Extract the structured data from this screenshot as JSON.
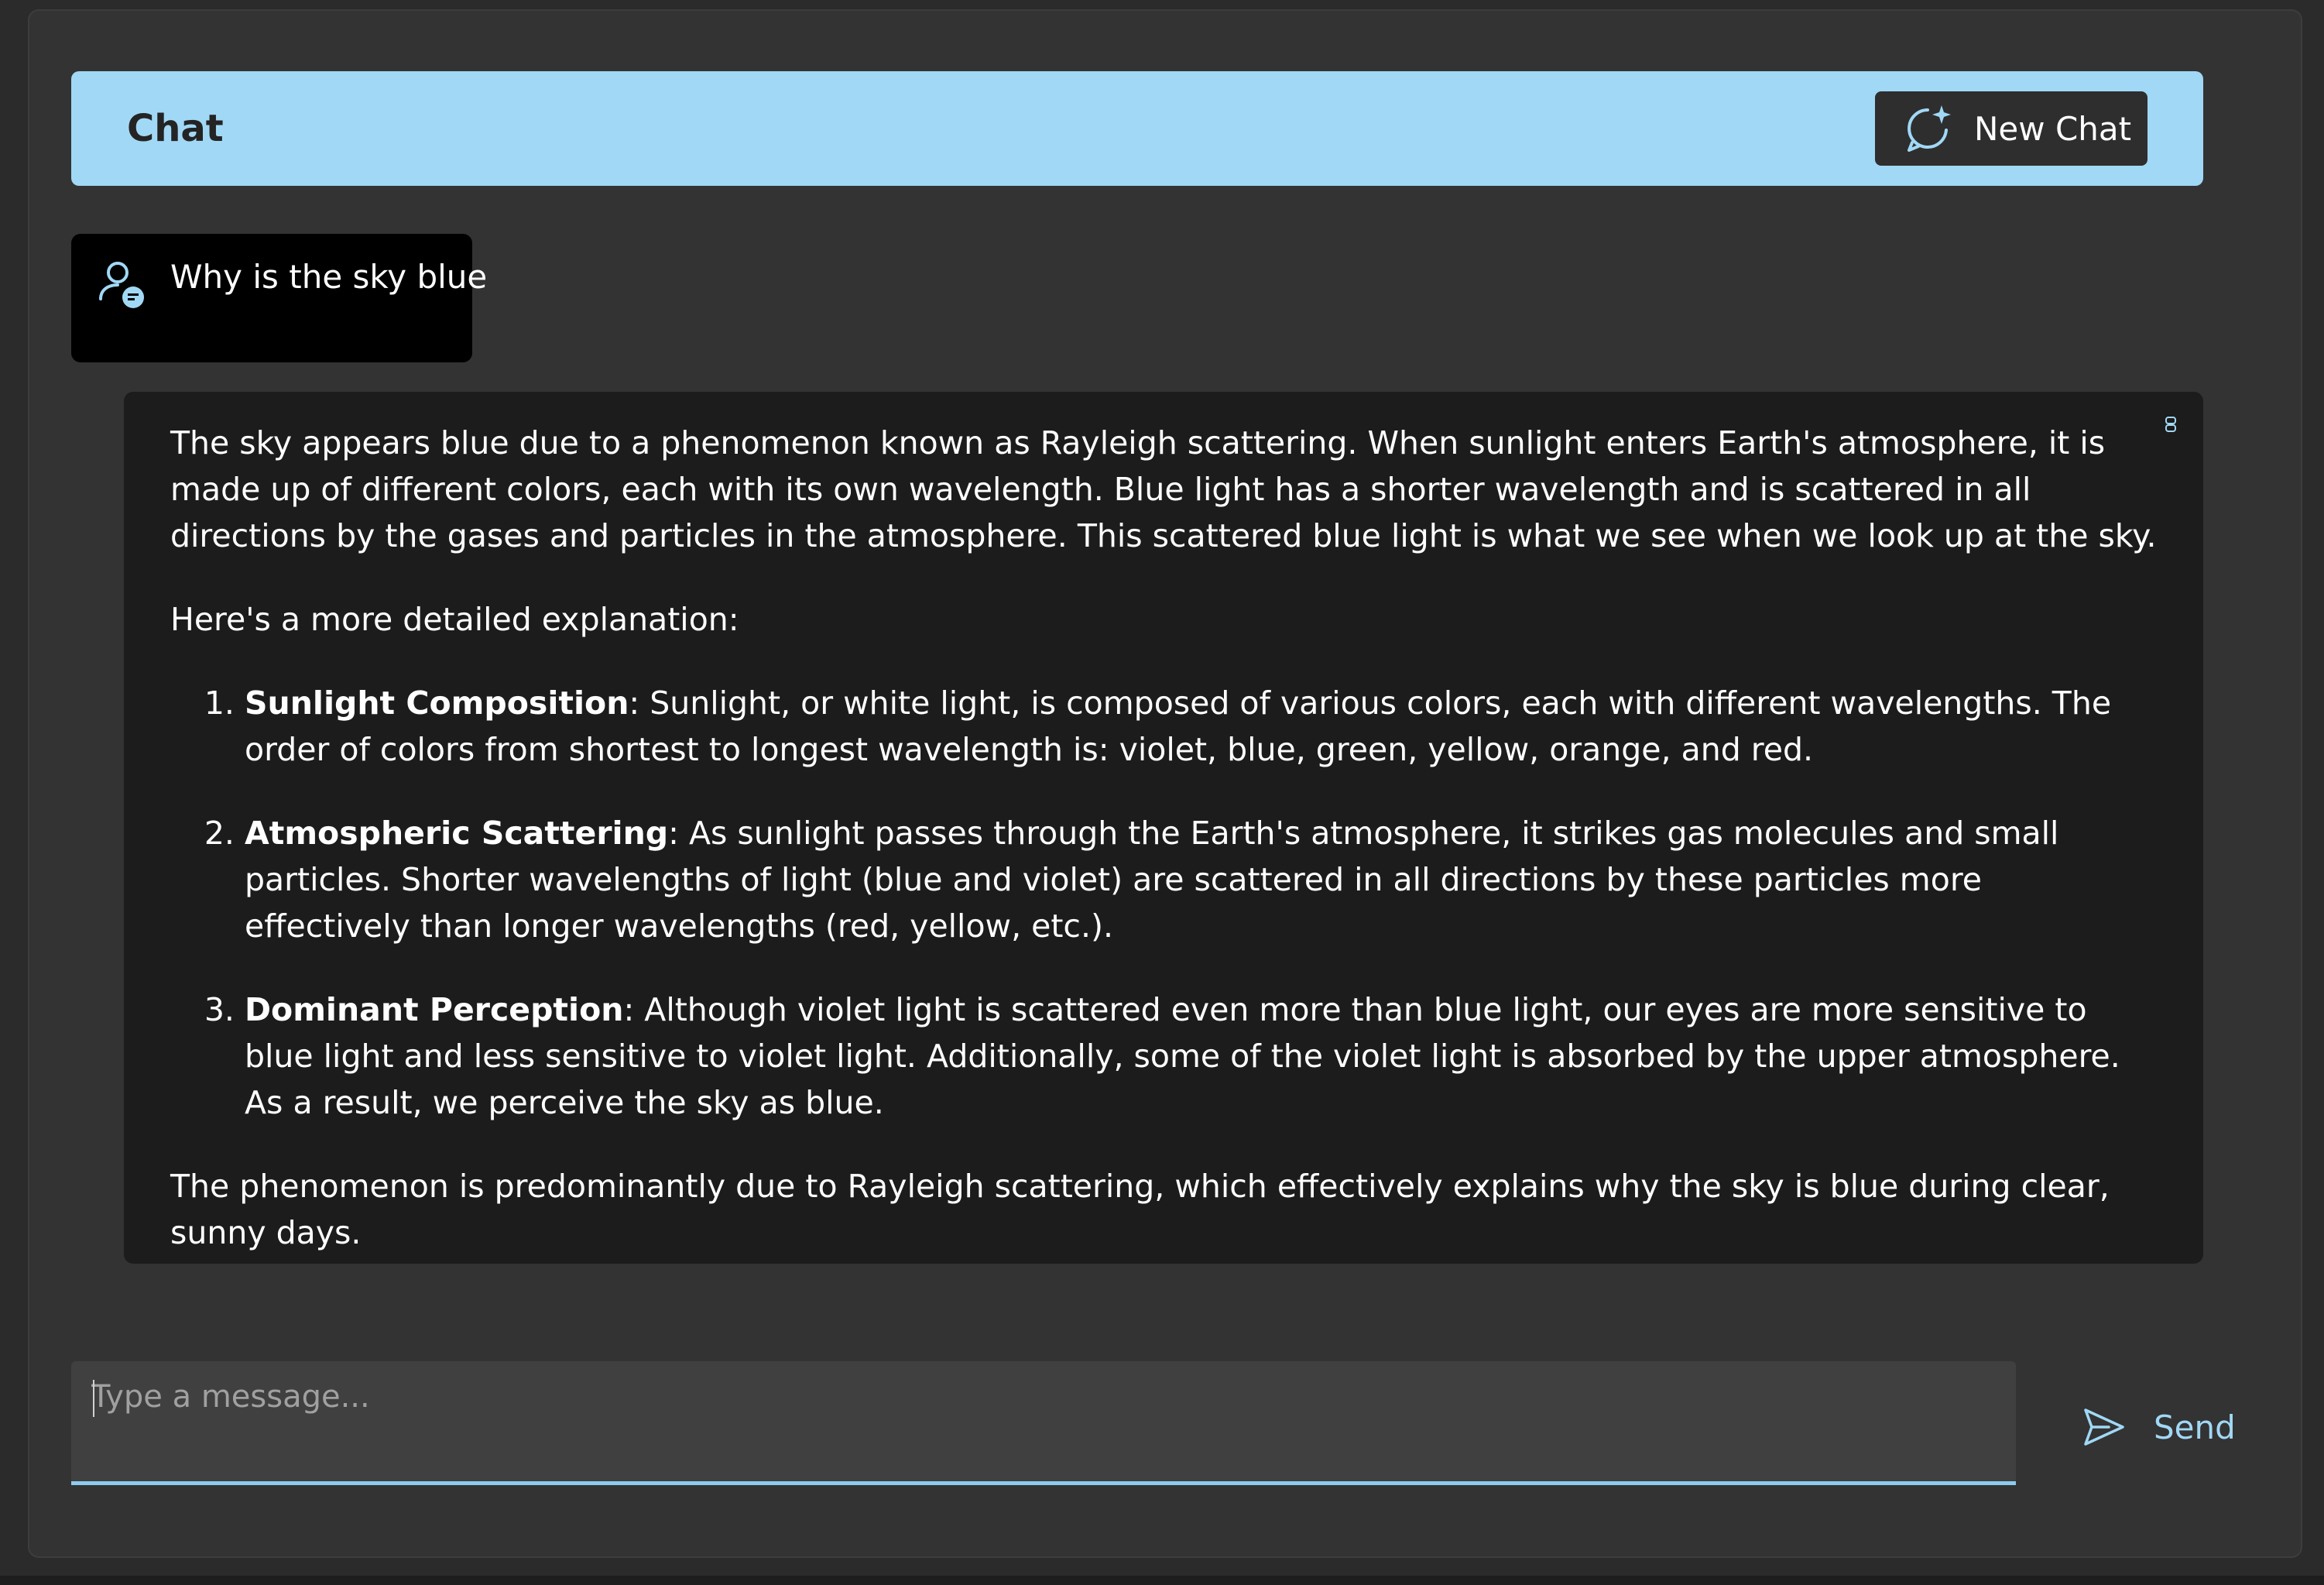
{
  "header": {
    "title": "Chat",
    "new_chat_label": "New Chat",
    "new_chat_icon": "chat-sparkle-icon"
  },
  "conversation": {
    "user_message": {
      "text": "Why is the sky blue",
      "avatar_icon": "person-chat-icon"
    },
    "assistant_message": {
      "copy_icon": "copy-icon",
      "intro": "The sky appears blue due to a phenomenon known as Rayleigh scattering. When sunlight enters Earth's atmosphere, it is made up of different colors, each with its own wavelength. Blue light has a shorter wavelength and is scattered in all directions by the gases and particles in the atmosphere. This scattered blue light is what we see when we look up at the sky.",
      "lead_in": "Here's a more detailed explanation:",
      "points": [
        {
          "title": "Sunlight Composition",
          "body": ": Sunlight, or white light, is composed of various colors, each with different wavelengths. The order of colors from shortest to longest wavelength is: violet, blue, green, yellow, orange, and red."
        },
        {
          "title": "Atmospheric Scattering",
          "body": ": As sunlight passes through the Earth's atmosphere, it strikes gas molecules and small particles. Shorter wavelengths of light (blue and violet) are scattered in all directions by these particles more effectively than longer wavelengths (red, yellow, etc.)."
        },
        {
          "title": "Dominant Perception",
          "body": ": Although violet light is scattered even more than blue light, our eyes are more sensitive to blue light and less sensitive to violet light. Additionally, some of the violet light is absorbed by the upper atmosphere. As a result, we perceive the sky as blue."
        }
      ],
      "conclusion": "The phenomenon is predominantly due to Rayleigh scattering, which effectively explains why the sky is blue during clear, sunny days."
    }
  },
  "composer": {
    "placeholder": "Type a message...",
    "value": "",
    "send_label": "Send",
    "send_icon": "send-icon"
  },
  "colors": {
    "accent": "#a1d8f6",
    "app_background": "#333333",
    "assistant_bubble": "#1c1c1c",
    "user_bubble": "#000000",
    "input_background": "#404040"
  }
}
